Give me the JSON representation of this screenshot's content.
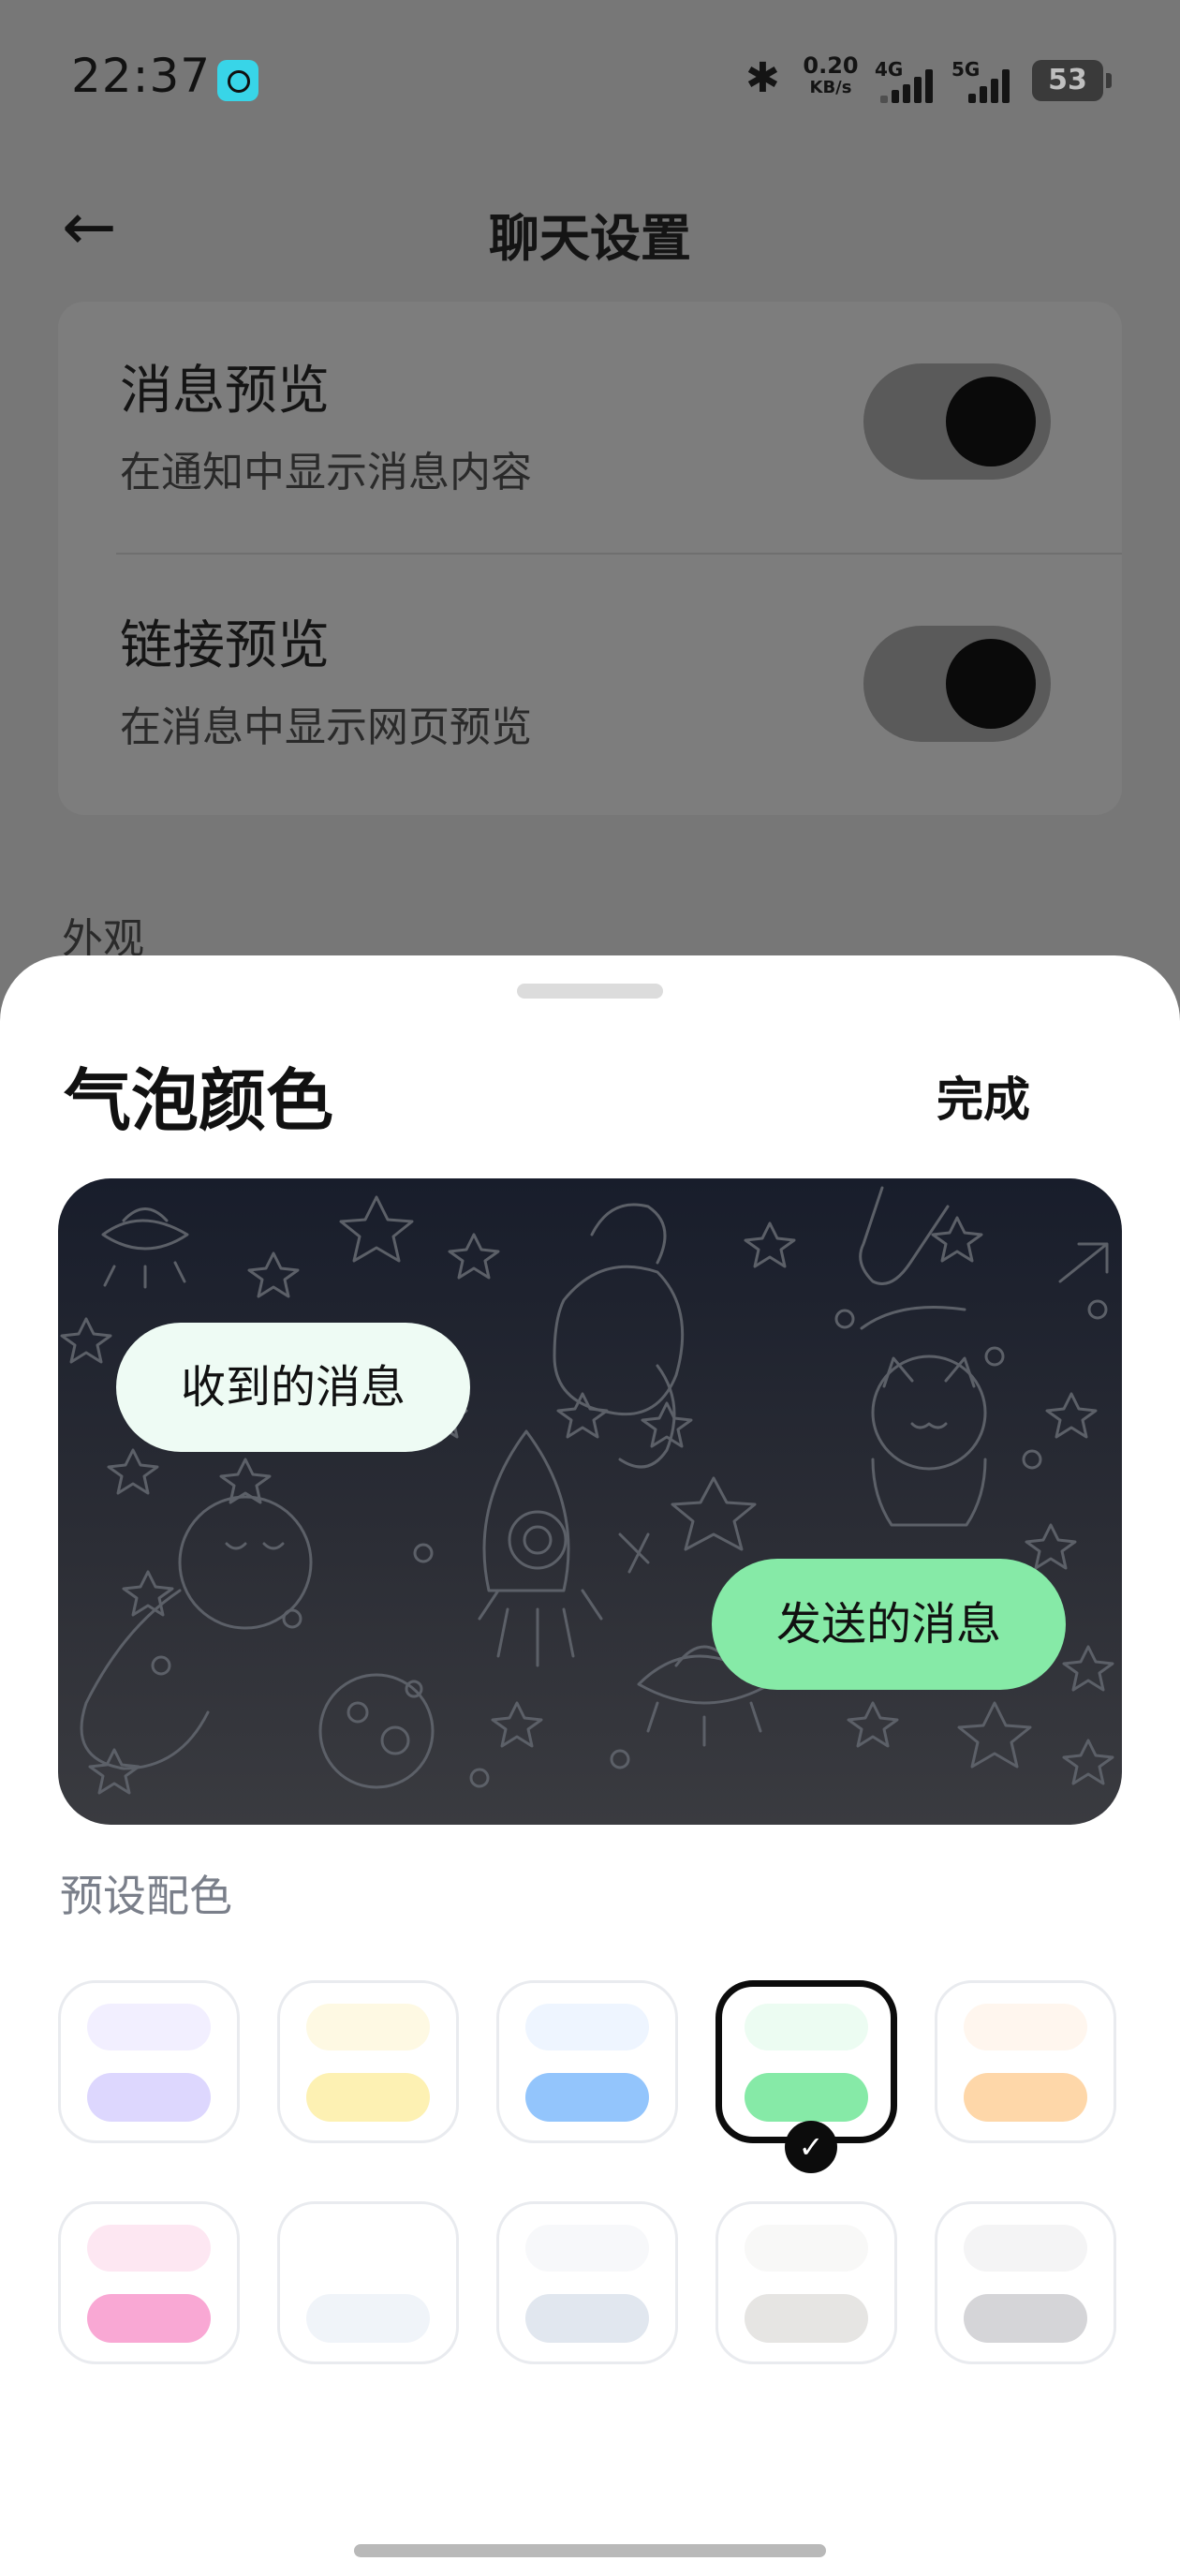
{
  "status_bar": {
    "time": "22:37",
    "bluetooth_icon": "bluetooth-icon",
    "net_speed_value": "0.20",
    "net_speed_unit": "KB/s",
    "signal_1_label": "4G",
    "signal_2_label": "5G",
    "battery": "53"
  },
  "header": {
    "back_icon": "arrow-left-icon",
    "title": "聊天设置"
  },
  "settings": [
    {
      "title": "消息预览",
      "subtitle": "在通知中显示消息内容",
      "toggle_on": true
    },
    {
      "title": "链接预览",
      "subtitle": "在消息中显示网页预览",
      "toggle_on": true
    }
  ],
  "section_label": "外观",
  "sheet": {
    "title": "气泡颜色",
    "done_label": "完成",
    "preview": {
      "received_label": "收到的消息",
      "sent_label": "发送的消息"
    },
    "preset_label": "预设配色",
    "selected_index": 3,
    "presets": [
      {
        "light": "#f2efff",
        "dark": "#ddd7fe"
      },
      {
        "light": "#fef9e3",
        "dark": "#fdf1b3"
      },
      {
        "light": "#eef5ff",
        "dark": "#93c5fc"
      },
      {
        "light": "#ecfcf2",
        "dark": "#86eaa7"
      },
      {
        "light": "#fff6ee",
        "dark": "#fed7a9"
      },
      {
        "light": "#fde7f2",
        "dark": "#f9a8d4"
      },
      {
        "light": "#ffffff",
        "dark": "#f0f4f9"
      },
      {
        "light": "#f7f8fa",
        "dark": "#e1e7ef"
      },
      {
        "light": "#f8f8f7",
        "dark": "#e6e5e3"
      },
      {
        "light": "#f4f4f5",
        "dark": "#d5d5d8"
      }
    ]
  }
}
